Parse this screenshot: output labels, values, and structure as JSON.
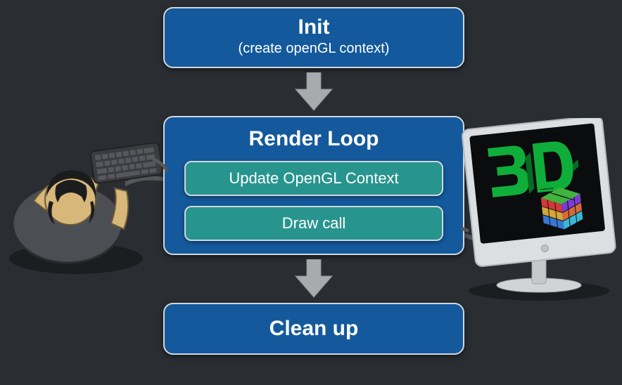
{
  "diagram": {
    "init": {
      "title": "Init",
      "subtitle": "(create openGL context)"
    },
    "render_loop": {
      "title": "Render Loop",
      "steps": {
        "update": "Update OpenGL Context",
        "draw": "Draw call"
      }
    },
    "cleanup": {
      "title": "Clean up"
    }
  },
  "illustrations": {
    "user_keyboard": "user-at-keyboard-top-down-icon",
    "monitor_3d": "monitor-showing-3d-content-icon"
  },
  "colors": {
    "background": "#2a2e33",
    "box_primary": "#14599c",
    "box_secondary": "#28948e",
    "border": "#cfd8de",
    "arrow": "#a8abad"
  }
}
